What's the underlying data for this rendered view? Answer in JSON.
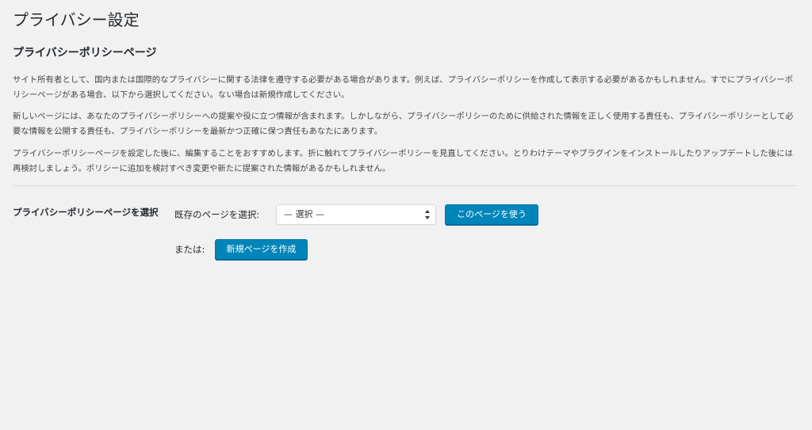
{
  "page": {
    "title": "プライバシー設定"
  },
  "section": {
    "heading": "プライバシーポリシーページ",
    "paragraphs": [
      "サイト所有者として、国内または国際的なプライバシーに関する法律を遵守する必要がある場合があります。例えば、プライバシーポリシーを作成して表示する必要があるかもしれません。すでにプライバシーポリシーページがある場合、以下から選択してください。ない場合は新規作成してください。",
      "新しいページには、あなたのプライバシーポリシーへの提案や役に立つ情報が含まれます。しかしながら、プライバシーポリシーのために供給された情報を正しく使用する責任も、プライバシーポリシーとして必要な情報を公開する責任も、プライバシーポリシーを最新かつ正確に保つ責任もあなたにあります。",
      "プライバシーポリシーページを設定した後に、編集することをおすすめします。折に触れてプライバシーポリシーを見直してください。とりわけテーマやプラグインをインストールしたりアップデートした後には再検討しましょう。ポリシーに追加を検討すべき変更や新たに提案された情報があるかもしれません。"
    ]
  },
  "form": {
    "row_label": "プライバシーポリシーページを選択",
    "existing_label": "既存のページを選択:",
    "select_value": "— 選択 —",
    "use_button": "このページを使う",
    "or_label": "または:",
    "create_button": "新規ページを作成"
  },
  "colors": {
    "background": "#f1f1f1",
    "primary_button": "#0085ba",
    "text": "#23282d"
  }
}
